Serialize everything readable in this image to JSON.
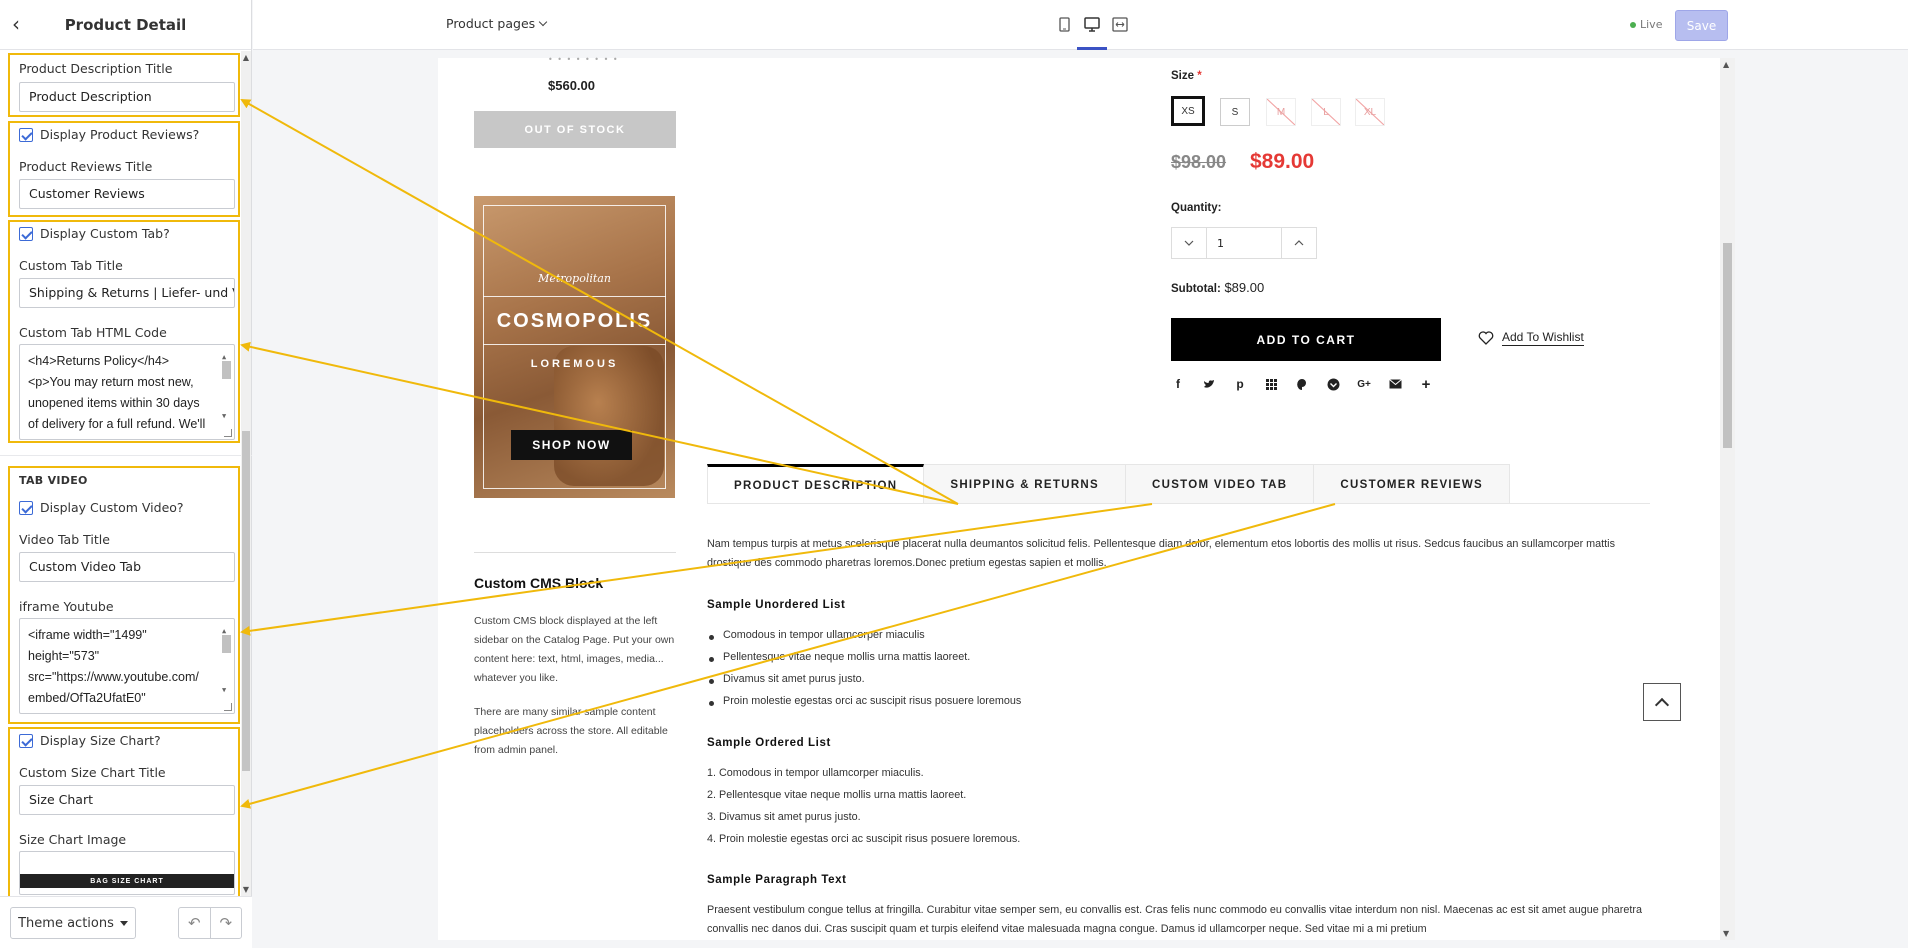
{
  "sidebar": {
    "title": "Product Detail",
    "product_description": {
      "label": "Product Description Title",
      "value": "Product Description"
    },
    "reviews": {
      "checkbox": "Display Product Reviews?",
      "label": "Product Reviews Title",
      "value": "Customer Reviews"
    },
    "custom_tab": {
      "checkbox": "Display Custom Tab?",
      "title_label": "Custom Tab Title",
      "title_value": "Shipping & Returns | Liefer- und Ve",
      "code_label": "Custom Tab HTML Code",
      "code_lines": [
        "<h4>Returns Policy</h4>",
        "<p>You may return most new,",
        "unopened items within 30 days",
        "of delivery for a full refund. We'll"
      ]
    },
    "video": {
      "section": "TAB VIDEO",
      "checkbox": "Display Custom Video?",
      "title_label": "Video Tab Title",
      "title_value": "Custom Video Tab",
      "iframe_label": "iframe Youtube",
      "iframe_lines": [
        "<iframe width=\"1499\"",
        "height=\"573\"",
        "src=\"https://www.youtube.com/",
        "embed/OfTa2UfatE0\""
      ]
    },
    "size_chart": {
      "checkbox": "Display Size Chart?",
      "title_label": "Custom Size Chart Title",
      "title_value": "Size Chart",
      "image_label": "Size Chart Image",
      "image_caption": "BAG SIZE CHART"
    },
    "footer": {
      "theme_actions": "Theme actions"
    }
  },
  "topbar": {
    "page_selector": "Product pages",
    "live_label": "Live",
    "save_label": "Save"
  },
  "preview": {
    "left_price": "$560.00",
    "out_of_stock": "OUT OF STOCK",
    "banner": {
      "brand": "Metropolitan",
      "headline": "COSMOPOLIS",
      "subhead": "LOREMOUS",
      "cta": "SHOP NOW"
    },
    "cms": {
      "title": "Custom CMS Block",
      "p1": "Custom CMS block displayed at the left sidebar on the Catalog Page. Put your own content here: text, html, images, media... whatever you like.",
      "p2": "There are many similar sample content placeholders across the store. All editable from admin panel."
    },
    "product": {
      "size_label": "Size",
      "size_required": "*",
      "sizes": [
        "XS",
        "S",
        "M",
        "L",
        "XL"
      ],
      "old_price": "$98.00",
      "new_price": "$89.00",
      "quantity_label": "Quantity:",
      "quantity_value": "1",
      "subtotal_label": "Subtotal:",
      "subtotal_value": "$89.00",
      "add_to_cart": "ADD TO CART",
      "wishlist": "Add To Wishlist"
    },
    "tabs": [
      "PRODUCT DESCRIPTION",
      "SHIPPING & RETURNS",
      "CUSTOM VIDEO TAB",
      "CUSTOMER REVIEWS"
    ],
    "description": {
      "intro": "Nam tempus turpis at metus scelerisque placerat nulla deumantos solicitud felis. Pellentesque diam dolor, elementum etos lobortis des mollis ut risus. Sedcus faucibus an sullamcorper mattis drostique des commodo pharetras loremos.Donec pretium egestas sapien et mollis.",
      "ul_title": "Sample Unordered List",
      "ul_items": [
        "Comodous in tempor ullamcorper miaculis",
        "Pellentesque vitae neque mollis urna mattis laoreet.",
        "Divamus sit amet purus justo.",
        "Proin molestie egestas orci ac suscipit risus posuere loremous"
      ],
      "ol_title": "Sample Ordered List",
      "ol_items": [
        "1. Comodous in tempor ullamcorper miaculis.",
        "2. Pellentesque vitae neque mollis urna mattis laoreet.",
        "3. Divamus sit amet purus justo.",
        "4. Proin molestie egestas orci ac suscipit risus posuere loremous."
      ],
      "p_title": "Sample Paragraph Text",
      "paragraph": "Praesent vestibulum congue tellus at fringilla. Curabitur vitae semper sem, eu convallis est. Cras felis nunc commodo eu convallis vitae interdum non nisl. Maecenas ac est sit amet augue pharetra convallis nec danos dui. Cras suscipit quam et turpis eleifend vitae malesuada magna congue. Damus id ullamcorper neque. Sed vitae mi a mi pretium"
    }
  },
  "colors": {
    "annotation": "#f0b90b",
    "accent": "#3b52c4",
    "sale": "#e53935"
  }
}
